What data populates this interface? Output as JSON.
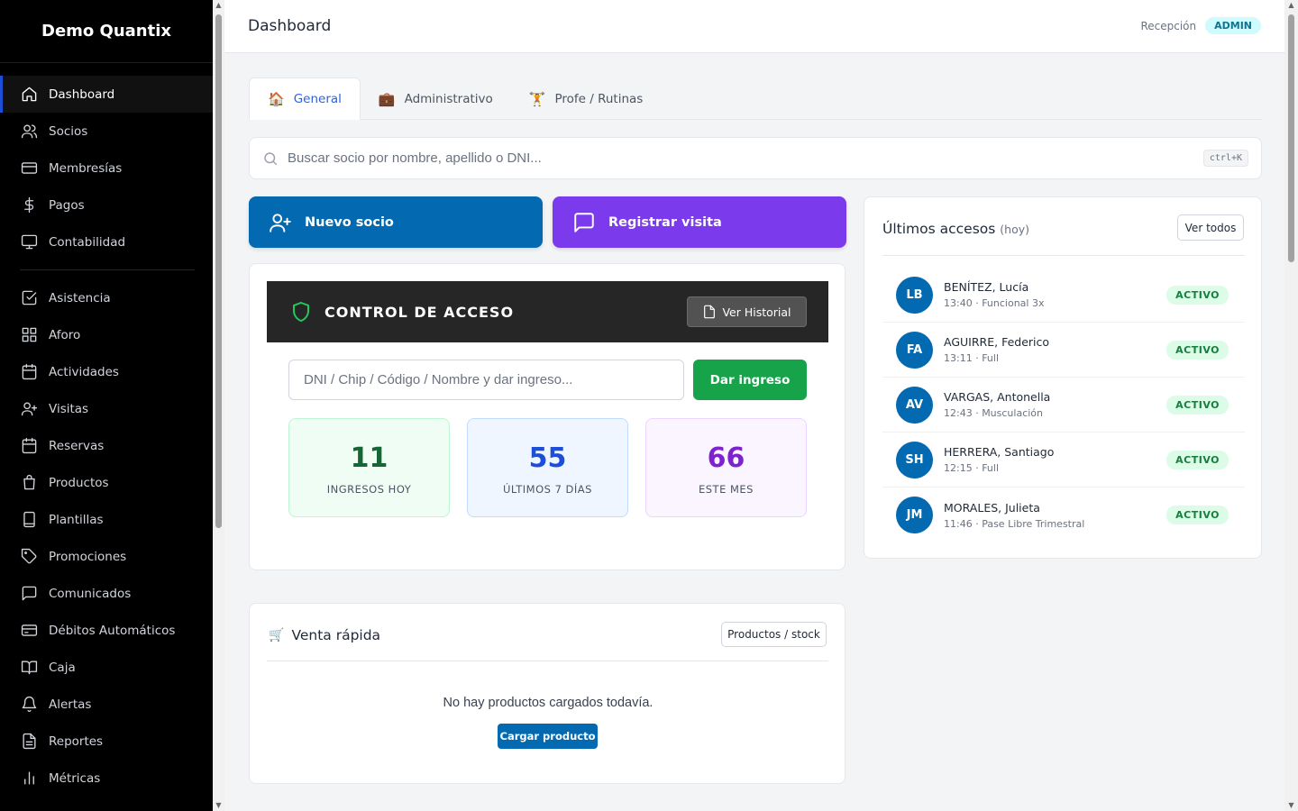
{
  "app": {
    "brand": "Demo Quantix"
  },
  "sidebar": {
    "items": [
      {
        "label": "Dashboard",
        "icon": "home-icon",
        "active": true
      },
      {
        "label": "Socios",
        "icon": "users-icon"
      },
      {
        "label": "Membresías",
        "icon": "credit-card-icon"
      },
      {
        "label": "Pagos",
        "icon": "dollar-icon"
      },
      {
        "label": "Contabilidad",
        "icon": "monitor-icon"
      },
      {
        "label": "Asistencia",
        "icon": "check-square-icon"
      },
      {
        "label": "Aforo",
        "icon": "grid-icon"
      },
      {
        "label": "Actividades",
        "icon": "calendar-icon"
      },
      {
        "label": "Visitas",
        "icon": "user-plus-icon"
      },
      {
        "label": "Reservas",
        "icon": "calendar-icon"
      },
      {
        "label": "Productos",
        "icon": "bag-icon"
      },
      {
        "label": "Plantillas",
        "icon": "tablet-icon"
      },
      {
        "label": "Promociones",
        "icon": "tag-icon"
      },
      {
        "label": "Comunicados",
        "icon": "message-icon"
      },
      {
        "label": "Débitos Automáticos",
        "icon": "card-icon"
      },
      {
        "label": "Caja",
        "icon": "book-icon"
      },
      {
        "label": "Alertas",
        "icon": "bell-icon"
      },
      {
        "label": "Reportes",
        "icon": "file-icon"
      },
      {
        "label": "Métricas",
        "icon": "bar-chart-icon"
      }
    ]
  },
  "header": {
    "title": "Dashboard",
    "user": "Recepción",
    "role": "ADMIN"
  },
  "tabs": [
    {
      "label": "General",
      "emoji": "🏠",
      "active": true
    },
    {
      "label": "Administrativo",
      "emoji": "💼"
    },
    {
      "label": "Profe / Rutinas",
      "emoji": "🏋"
    }
  ],
  "search": {
    "placeholder": "Buscar socio por nombre, apellido o DNI...",
    "shortcut": "ctrl+K"
  },
  "actions": {
    "new_member": "Nuevo socio",
    "register_visit": "Registrar visita"
  },
  "access_control": {
    "title": "CONTROL DE ACCESO",
    "history_button": "Ver Historial",
    "input_placeholder": "DNI / Chip / Código / Nombre y dar ingreso...",
    "submit": "Dar ingreso",
    "stats": [
      {
        "value": "11",
        "label": "INGRESOS HOY"
      },
      {
        "value": "55",
        "label": "ÚLTIMOS 7 DÍAS"
      },
      {
        "value": "66",
        "label": "ESTE MES"
      }
    ]
  },
  "quick_sale": {
    "title": "Venta rápida",
    "emoji": "🛒",
    "stock_button": "Productos / stock",
    "empty": "No hay productos cargados todavía.",
    "load_button": "Cargar producto"
  },
  "recent_access": {
    "title": "Últimos accesos",
    "subtitle": "(hoy)",
    "view_all": "Ver todos",
    "rows": [
      {
        "initials": "LB",
        "name": "BENÍTEZ, Lucía",
        "meta": "13:40 · Funcional 3x",
        "status": "ACTIVO"
      },
      {
        "initials": "FA",
        "name": "AGUIRRE, Federico",
        "meta": "13:11 · Full",
        "status": "ACTIVO"
      },
      {
        "initials": "AV",
        "name": "VARGAS, Antonella",
        "meta": "12:43 · Musculación",
        "status": "ACTIVO"
      },
      {
        "initials": "SH",
        "name": "HERRERA, Santiago",
        "meta": "12:15 · Full",
        "status": "ACTIVO"
      },
      {
        "initials": "JM",
        "name": "MORALES, Julieta",
        "meta": "11:46 · Pase Libre Trimestral",
        "status": "ACTIVO"
      }
    ]
  },
  "colors": {
    "primary": "#0369b1",
    "purple": "#7c3aed",
    "success": "#16a34a"
  }
}
